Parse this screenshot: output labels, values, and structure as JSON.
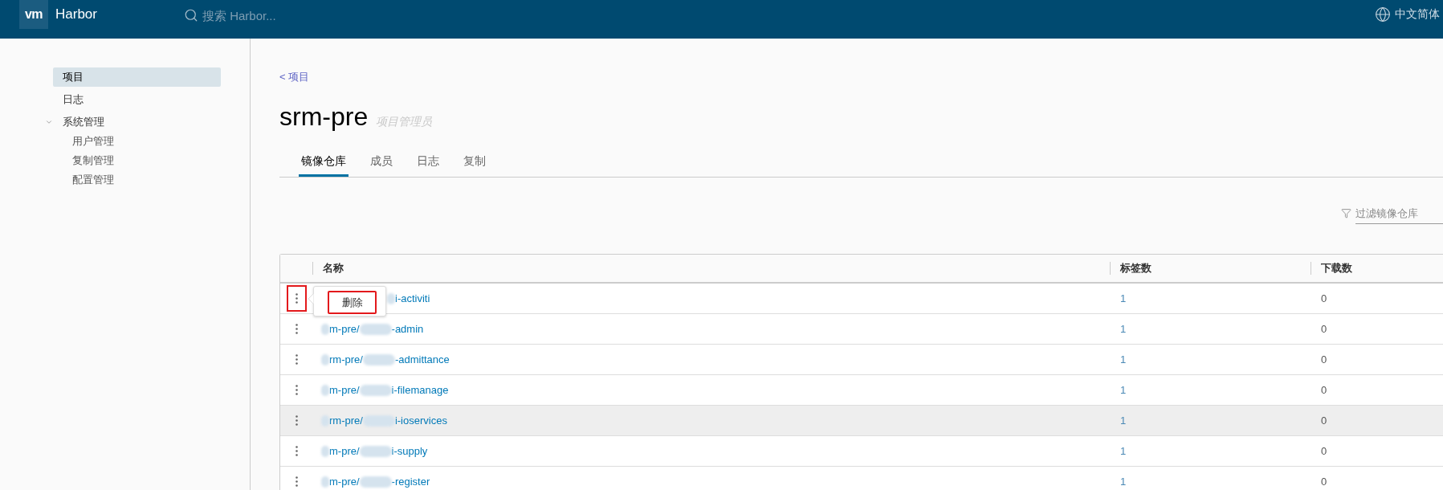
{
  "header": {
    "logo": "vm",
    "brand": "Harbor",
    "search": {
      "placeholder": "搜索 Harbor..."
    },
    "language": "中文简体"
  },
  "sidebar": {
    "items": [
      {
        "label": "项目",
        "selected": true
      },
      {
        "label": "日志",
        "selected": false
      },
      {
        "label": "系统管理",
        "selected": false,
        "expanded": true,
        "children": [
          {
            "label": "用户管理",
            "selected": false
          },
          {
            "label": "复制管理",
            "selected": false
          },
          {
            "label": "配置管理",
            "selected": false
          }
        ]
      }
    ]
  },
  "breadcrumb": "< 项目",
  "project": {
    "name": "srm-pre",
    "role": "项目管理员"
  },
  "tabs": [
    {
      "label": "镜像仓库",
      "selected": true
    },
    {
      "label": "成员",
      "selected": false
    },
    {
      "label": "日志",
      "selected": false
    },
    {
      "label": "复制",
      "selected": false
    }
  ],
  "filter": {
    "placeholder": "过滤镜像仓库"
  },
  "table": {
    "columns": [
      "名称",
      "标签数",
      "下载数"
    ],
    "rows": [
      {
        "name_parts": [
          "i-activiti"
        ],
        "tags": "1",
        "downloads": "0",
        "hovered": false,
        "annotated": true,
        "menu": {
          "items": [
            {
              "label": "删除",
              "annotated": true
            }
          ]
        }
      },
      {
        "name_parts": [
          "m-pre/",
          "-admin"
        ],
        "tags": "1",
        "downloads": "0",
        "hovered": false,
        "annotated": false
      },
      {
        "name_parts": [
          "rm-pre/",
          "-admittance"
        ],
        "tags": "1",
        "downloads": "0",
        "hovered": false,
        "annotated": false
      },
      {
        "name_parts": [
          "m-pre/",
          "i-filemanage"
        ],
        "tags": "1",
        "downloads": "0",
        "hovered": false,
        "annotated": false
      },
      {
        "name_parts": [
          "rm-pre/",
          "i-ioservices"
        ],
        "tags": "1",
        "downloads": "0",
        "hovered": true,
        "annotated": false
      },
      {
        "name_parts": [
          "m-pre/",
          "i-supply"
        ],
        "tags": "1",
        "downloads": "0",
        "hovered": false,
        "annotated": false
      },
      {
        "name_parts": [
          "m-pre/",
          "-register"
        ],
        "tags": "1",
        "downloads": "0",
        "hovered": false,
        "annotated": false
      }
    ]
  }
}
